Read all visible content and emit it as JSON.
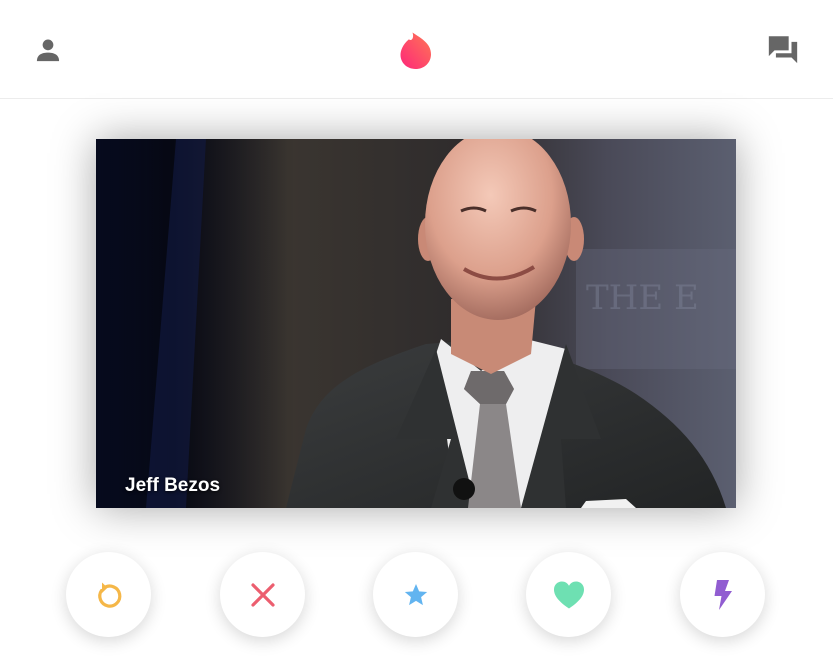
{
  "profile": {
    "name": "Jeff Bezos"
  },
  "colors": {
    "header_icon": "#666666",
    "logo_gradient_start": "#fd267a",
    "logo_gradient_end": "#ff7854",
    "rewind": "#f5b748",
    "nope": "#ec5e6f",
    "super_like": "#62b4f0",
    "like": "#6ee0b2",
    "boost": "#915dd1"
  },
  "icons": {
    "profile": "person-icon",
    "logo": "flame-icon",
    "messages": "chat-icon",
    "rewind": "rewind-icon",
    "nope": "close-icon",
    "super_like": "star-icon",
    "like": "heart-icon",
    "boost": "lightning-icon"
  }
}
